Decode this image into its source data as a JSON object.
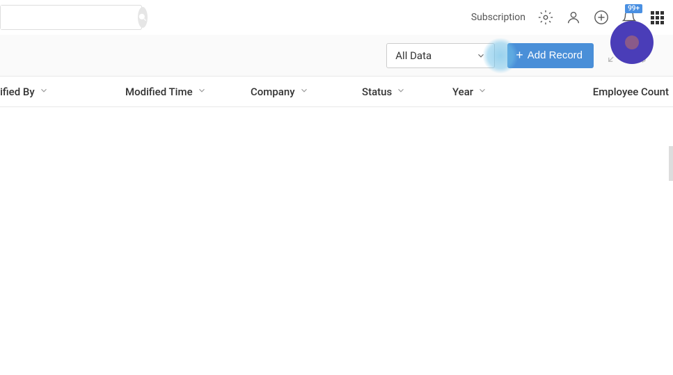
{
  "header": {
    "search_placeholder": "",
    "subscription_label": "Subscription",
    "notification_badge": "99+"
  },
  "toolbar": {
    "filter_selected": "All Data",
    "add_record_label": "Add Record"
  },
  "columns": {
    "modified_by": "Modified By",
    "modified_time": "Modified Time",
    "company": "Company",
    "status": "Status",
    "year": "Year",
    "employee_count": "Employee Count"
  }
}
